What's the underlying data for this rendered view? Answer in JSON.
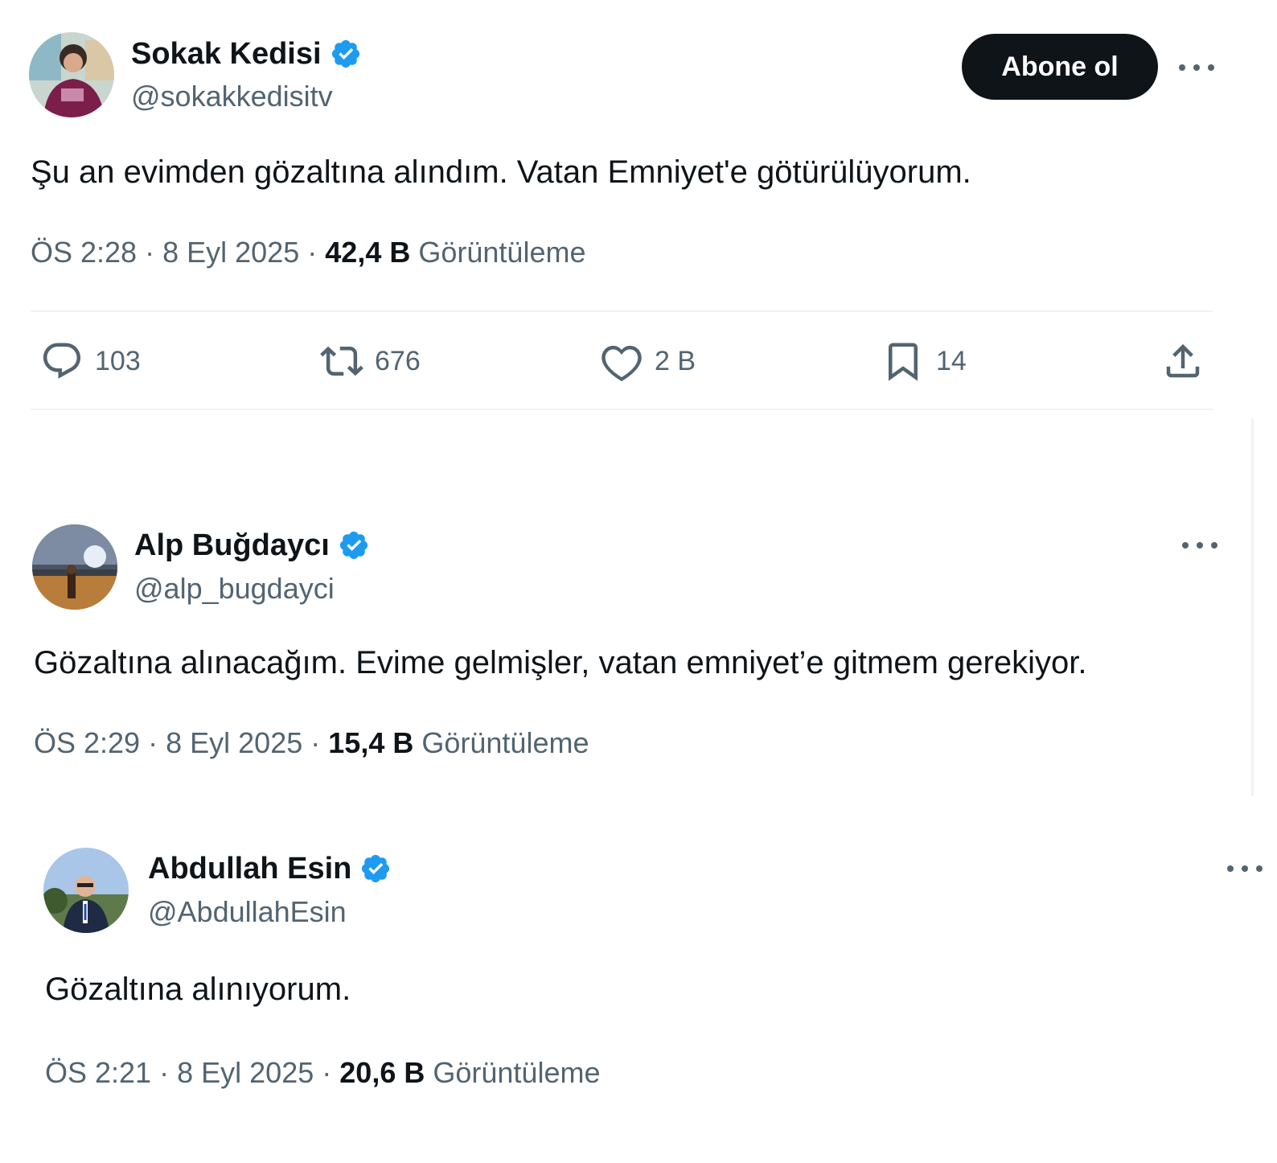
{
  "tweets": [
    {
      "name": "Sokak Kedisi",
      "handle": "@sokakkedisitv",
      "follow_label": "Abone ol",
      "text": "Şu an evimden gözaltına alındım. Vatan Emniyet'e götürülüyorum.",
      "time": "ÖS 2:28",
      "date": "8 Eyl 2025",
      "views": "42,4 B",
      "views_label": "Görüntüleme",
      "replies": "103",
      "reposts": "676",
      "likes": "2 B",
      "bookmarks": "14"
    },
    {
      "name": "Alp Buğdaycı",
      "handle": "@alp_bugdayci",
      "text": "Gözaltına alınacağım. Evime gelmişler, vatan emniyet’e gitmem gerekiyor.",
      "time": "ÖS 2:29",
      "date": "8 Eyl 2025",
      "views": "15,4 B",
      "views_label": "Görüntüleme"
    },
    {
      "name": "Abdullah Esin",
      "handle": "@AbdullahEsin",
      "text": "Gözaltına alınıyorum.",
      "time": "ÖS 2:21",
      "date": "8 Eyl 2025",
      "views": "20,6 B",
      "views_label": "Görüntüleme"
    }
  ],
  "separator": "·",
  "colors": {
    "text": "#0f1419",
    "secondary": "#536471",
    "verified": "#1d9bf0",
    "button": "#0f1419",
    "divider": "#eff3f4"
  },
  "icons": [
    "verified-badge-icon",
    "more-icon",
    "reply-icon",
    "repost-icon",
    "like-icon",
    "bookmark-icon",
    "share-icon"
  ]
}
